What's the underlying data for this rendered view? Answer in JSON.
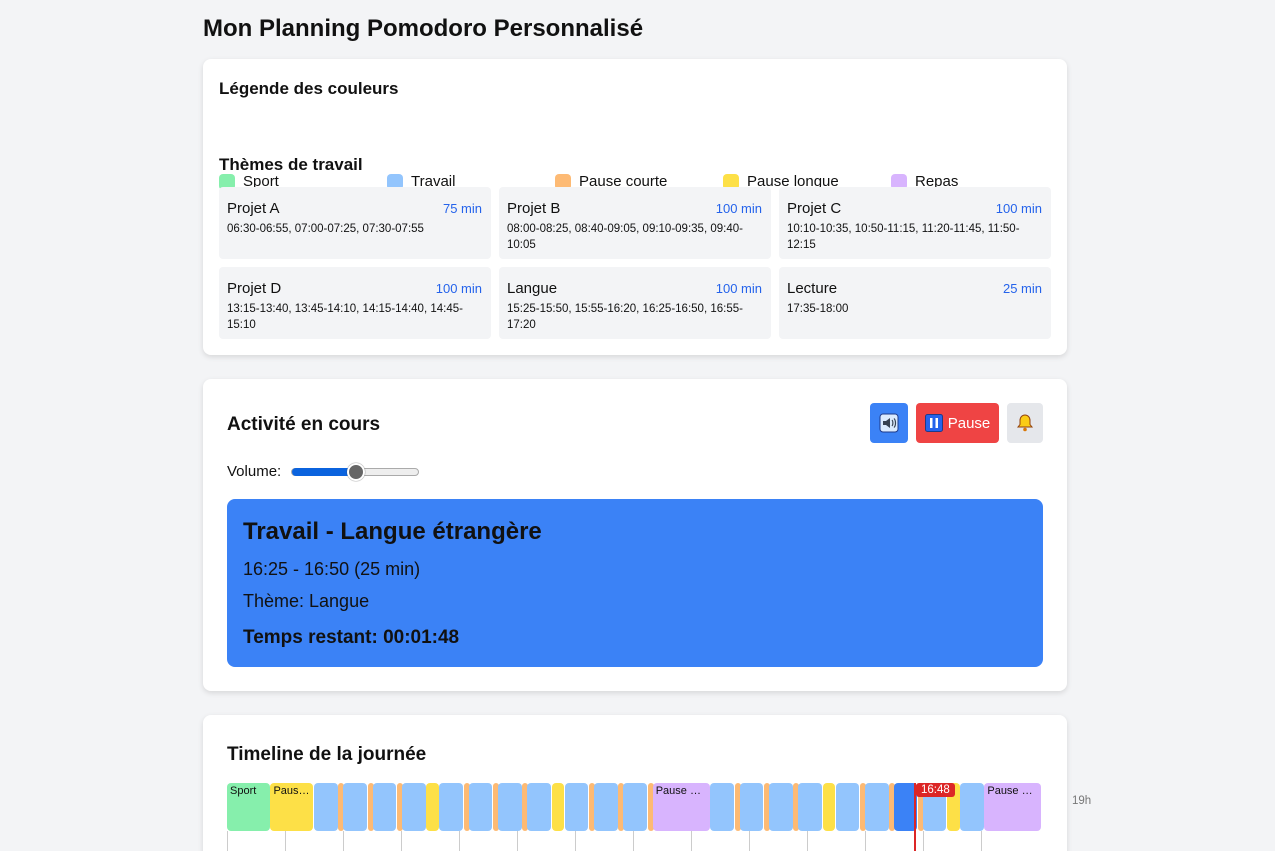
{
  "page_title": "Mon Planning Pomodoro Personnalisé",
  "legend": {
    "title": "Légende des couleurs",
    "items": [
      {
        "label": "Sport",
        "color": "#86efac"
      },
      {
        "label": "Travail",
        "color": "#93c5fd"
      },
      {
        "label": "Pause courte",
        "color": "#fdba74"
      },
      {
        "label": "Pause longue",
        "color": "#fde047"
      },
      {
        "label": "Repas",
        "color": "#d8b4fe"
      }
    ]
  },
  "themes": {
    "title": "Thèmes de travail",
    "items": [
      {
        "name": "Projet A",
        "minutes": "75 min",
        "slots": "06:30-06:55, 07:00-07:25, 07:30-07:55"
      },
      {
        "name": "Projet B",
        "minutes": "100 min",
        "slots": "08:00-08:25, 08:40-09:05, 09:10-09:35, 09:40-10:05"
      },
      {
        "name": "Projet C",
        "minutes": "100 min",
        "slots": "10:10-10:35, 10:50-11:15, 11:20-11:45, 11:50-12:15"
      },
      {
        "name": "Projet D",
        "minutes": "100 min",
        "slots": "13:15-13:40, 13:45-14:10, 14:15-14:40, 14:45-15:10"
      },
      {
        "name": "Langue",
        "minutes": "100 min",
        "slots": "15:25-15:50, 15:55-16:20, 16:25-16:50, 16:55-17:20"
      },
      {
        "name": "Lecture",
        "minutes": "25 min",
        "slots": "17:35-18:00"
      }
    ]
  },
  "current": {
    "title": "Activité en cours",
    "sound_icon": "speaker-icon",
    "pause_label": "Pause",
    "bell_icon": "bell-icon",
    "volume_label": "Volume:",
    "volume_level": 0.5,
    "activity_name": "Travail - Langue étrangère",
    "time_range": "16:25 - 16:50 (25 min)",
    "theme": "Thème: Langue",
    "remaining": "Temps restant: 00:01:48",
    "colors": {
      "active": "#3b82f6",
      "pause_button": "#ef4444",
      "sound_button": "#3b82f6"
    }
  },
  "timeline": {
    "title": "Timeline de la journée",
    "now_label": "16:48",
    "end_hour_label": "19h",
    "segments": [
      {
        "kind": "sport",
        "label": "Sport"
      },
      {
        "kind": "long",
        "label": "Pause longue"
      },
      {
        "kind": "work",
        "label": ""
      },
      {
        "kind": "short",
        "label": ""
      },
      {
        "kind": "work",
        "label": ""
      },
      {
        "kind": "short",
        "label": ""
      },
      {
        "kind": "work",
        "label": ""
      },
      {
        "kind": "short",
        "label": ""
      },
      {
        "kind": "work",
        "label": ""
      },
      {
        "kind": "long",
        "label": ""
      },
      {
        "kind": "work",
        "label": ""
      },
      {
        "kind": "short",
        "label": ""
      },
      {
        "kind": "work",
        "label": ""
      },
      {
        "kind": "short",
        "label": ""
      },
      {
        "kind": "work",
        "label": ""
      },
      {
        "kind": "short",
        "label": ""
      },
      {
        "kind": "work",
        "label": ""
      },
      {
        "kind": "long",
        "label": ""
      },
      {
        "kind": "work",
        "label": ""
      },
      {
        "kind": "short",
        "label": ""
      },
      {
        "kind": "work",
        "label": ""
      },
      {
        "kind": "short",
        "label": ""
      },
      {
        "kind": "work",
        "label": ""
      },
      {
        "kind": "short",
        "label": ""
      },
      {
        "kind": "meal",
        "label": "Pause déjeuner"
      },
      {
        "kind": "work",
        "label": ""
      },
      {
        "kind": "short",
        "label": ""
      },
      {
        "kind": "work",
        "label": ""
      },
      {
        "kind": "short",
        "label": ""
      },
      {
        "kind": "work",
        "label": ""
      },
      {
        "kind": "short",
        "label": ""
      },
      {
        "kind": "work",
        "label": ""
      },
      {
        "kind": "long",
        "label": ""
      },
      {
        "kind": "work",
        "label": ""
      },
      {
        "kind": "short",
        "label": ""
      },
      {
        "kind": "work",
        "label": ""
      },
      {
        "kind": "short",
        "label": ""
      },
      {
        "kind": "active",
        "label": ""
      },
      {
        "kind": "short",
        "label": ""
      },
      {
        "kind": "work",
        "label": ""
      },
      {
        "kind": "long",
        "label": ""
      },
      {
        "kind": "work",
        "label": ""
      },
      {
        "kind": "meal",
        "label": "Pause dîner"
      }
    ]
  }
}
